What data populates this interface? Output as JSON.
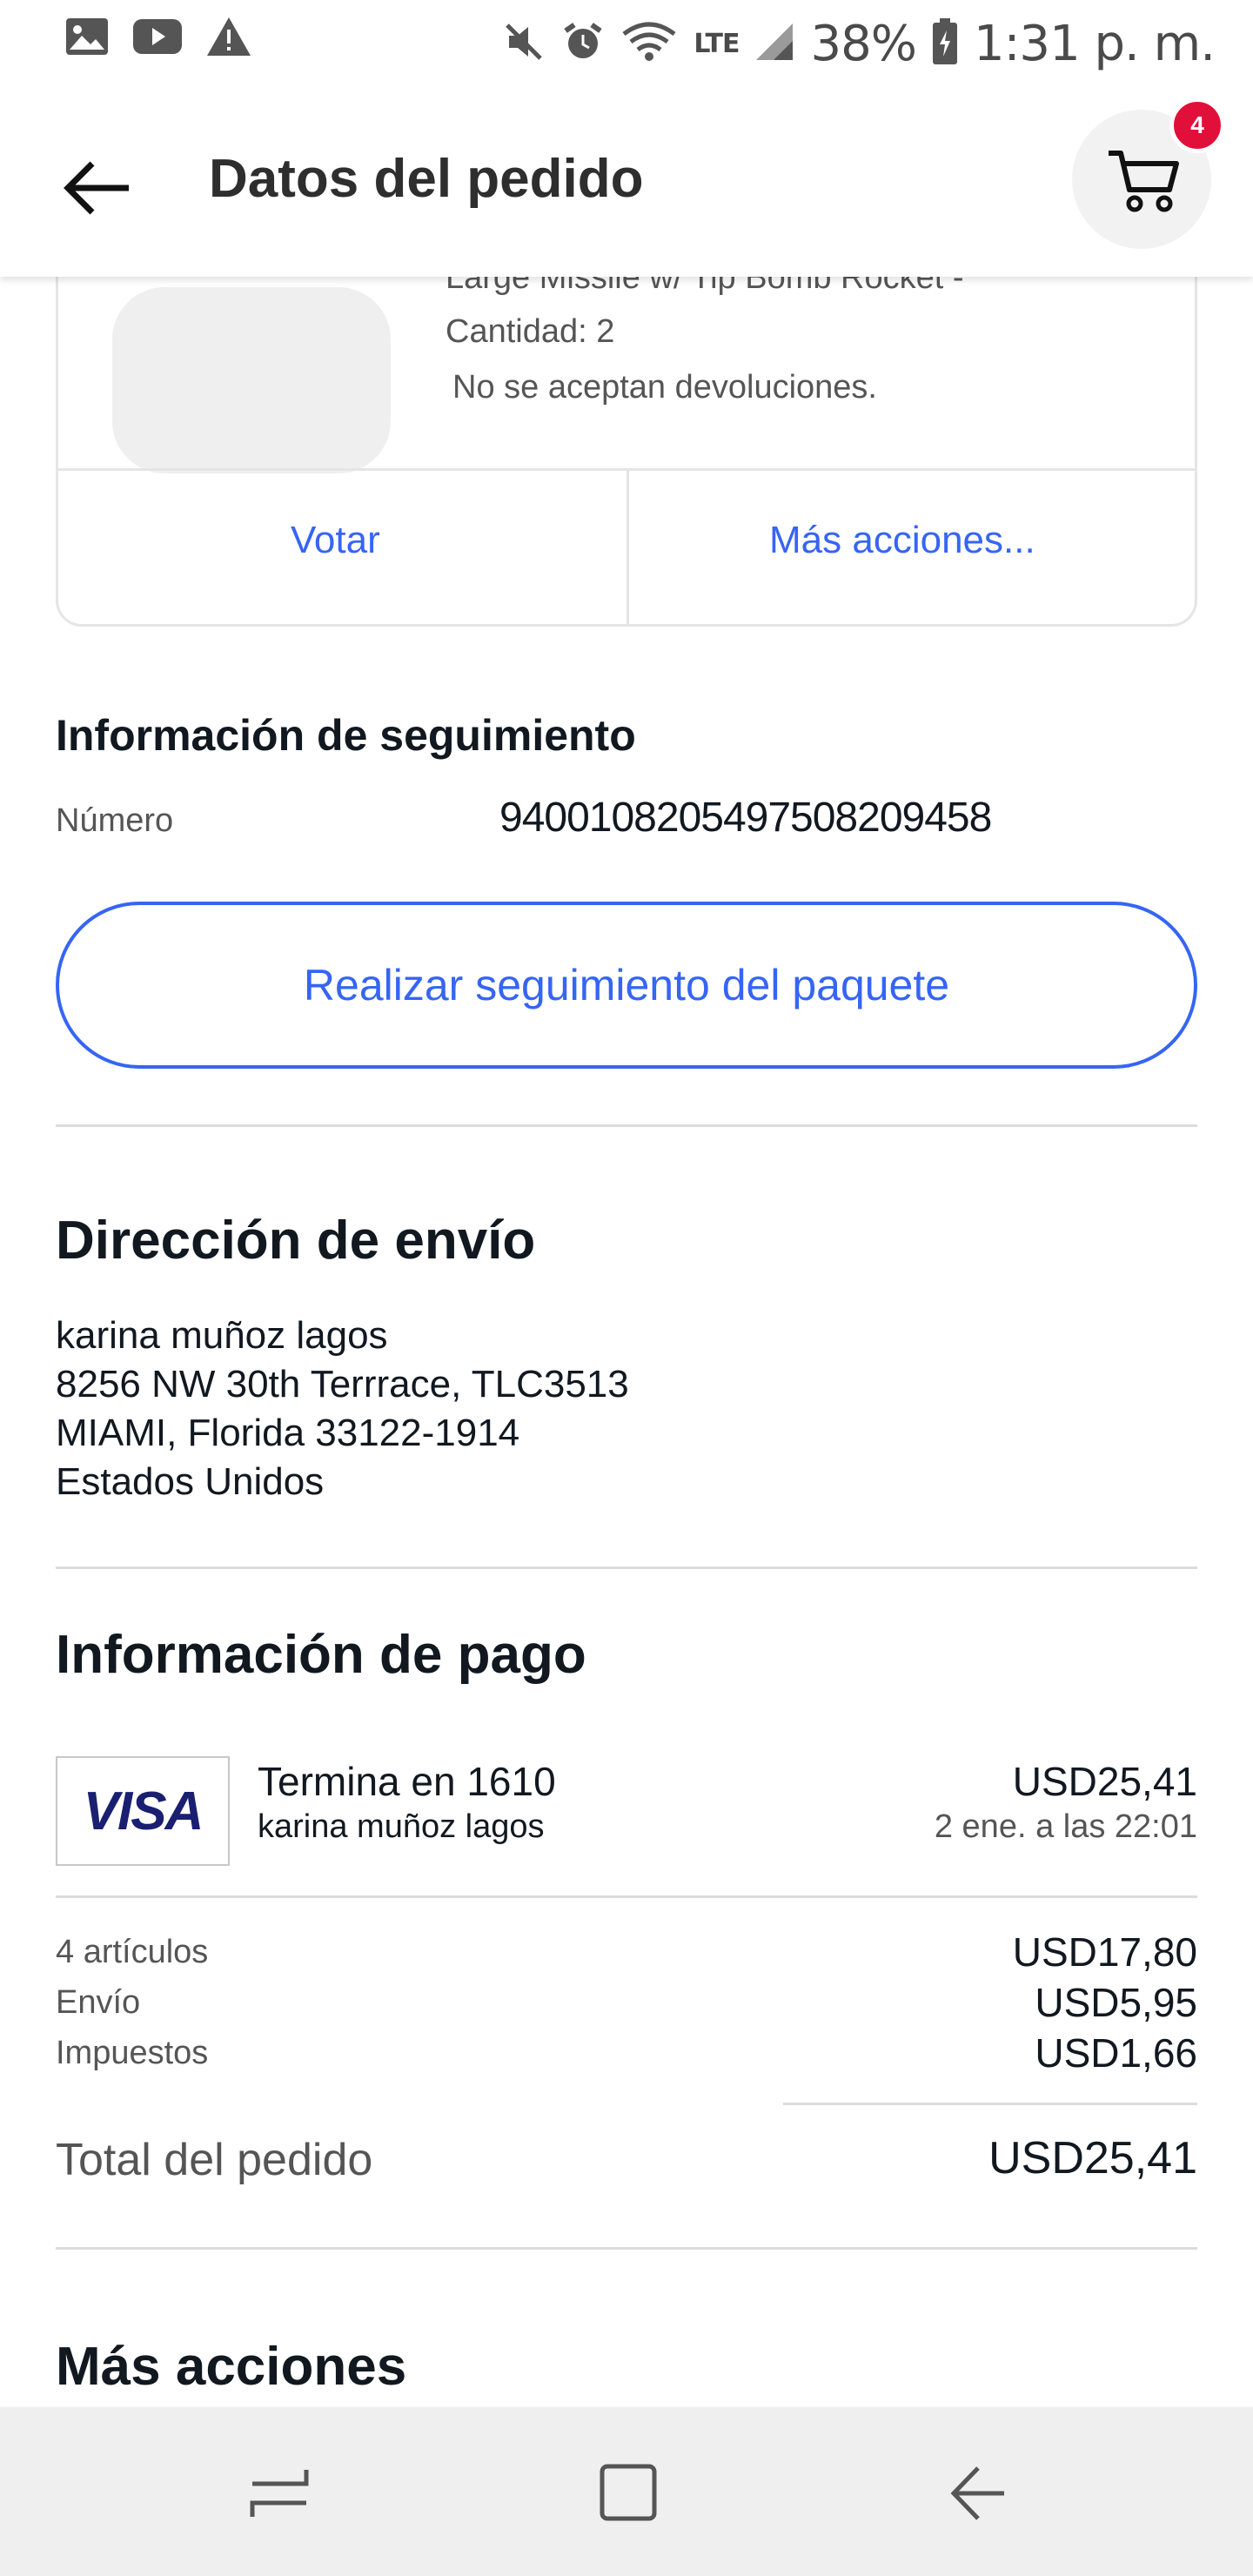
{
  "status_bar": {
    "battery": "38%",
    "time": "1:31 p. m.",
    "network": "LTE"
  },
  "app_bar": {
    "title": "Datos del pedido",
    "cart_count": "4"
  },
  "item": {
    "name": "Large Missile w/ Tip Bomb Rocket -",
    "quantity": "Cantidad: 2",
    "returns": "No se aceptan devoluciones.",
    "actions": {
      "vote": "Votar",
      "more": "Más acciones..."
    }
  },
  "tracking": {
    "title": "Información de seguimiento",
    "number_label": "Número",
    "number": "9400108205497508209458",
    "button": "Realizar seguimiento del paquete"
  },
  "shipping": {
    "title": "Dirección de envío",
    "lines": [
      "karina muñoz lagos",
      "8256 NW 30th Terrrace, TLC3513",
      "MIAMI, Florida 33122-1914",
      "Estados Unidos"
    ]
  },
  "payment": {
    "title": "Información de pago",
    "card_brand": "VISA",
    "card_ends": "Termina en 1610",
    "card_holder": "karina muñoz lagos",
    "amount": "USD25,41",
    "date": "2 ene. a las 22:01",
    "summary": [
      {
        "label": "4 artículos",
        "value": "USD17,80"
      },
      {
        "label": "Envío",
        "value": "USD5,95"
      },
      {
        "label": "Impuestos",
        "value": "USD1,66"
      }
    ],
    "total_label": "Total del pedido",
    "total_value": "USD25,41"
  },
  "more_actions": {
    "title": "Más acciones"
  },
  "colors": {
    "accent": "#3665f3",
    "badge": "#e0103a",
    "text": "#111820",
    "secondary": "#555555"
  },
  "icons": {
    "back": "arrow-left-icon",
    "cart": "cart-icon",
    "gallery": "image-icon",
    "youtube": "youtube-icon",
    "warning": "warning-icon",
    "mute": "mute-icon",
    "alarm": "alarm-icon",
    "wifi": "wifi-icon",
    "signal": "signal-icon",
    "battery": "battery-icon",
    "recents": "recents-icon",
    "home": "home-icon",
    "nav_back": "nav-back-icon"
  }
}
